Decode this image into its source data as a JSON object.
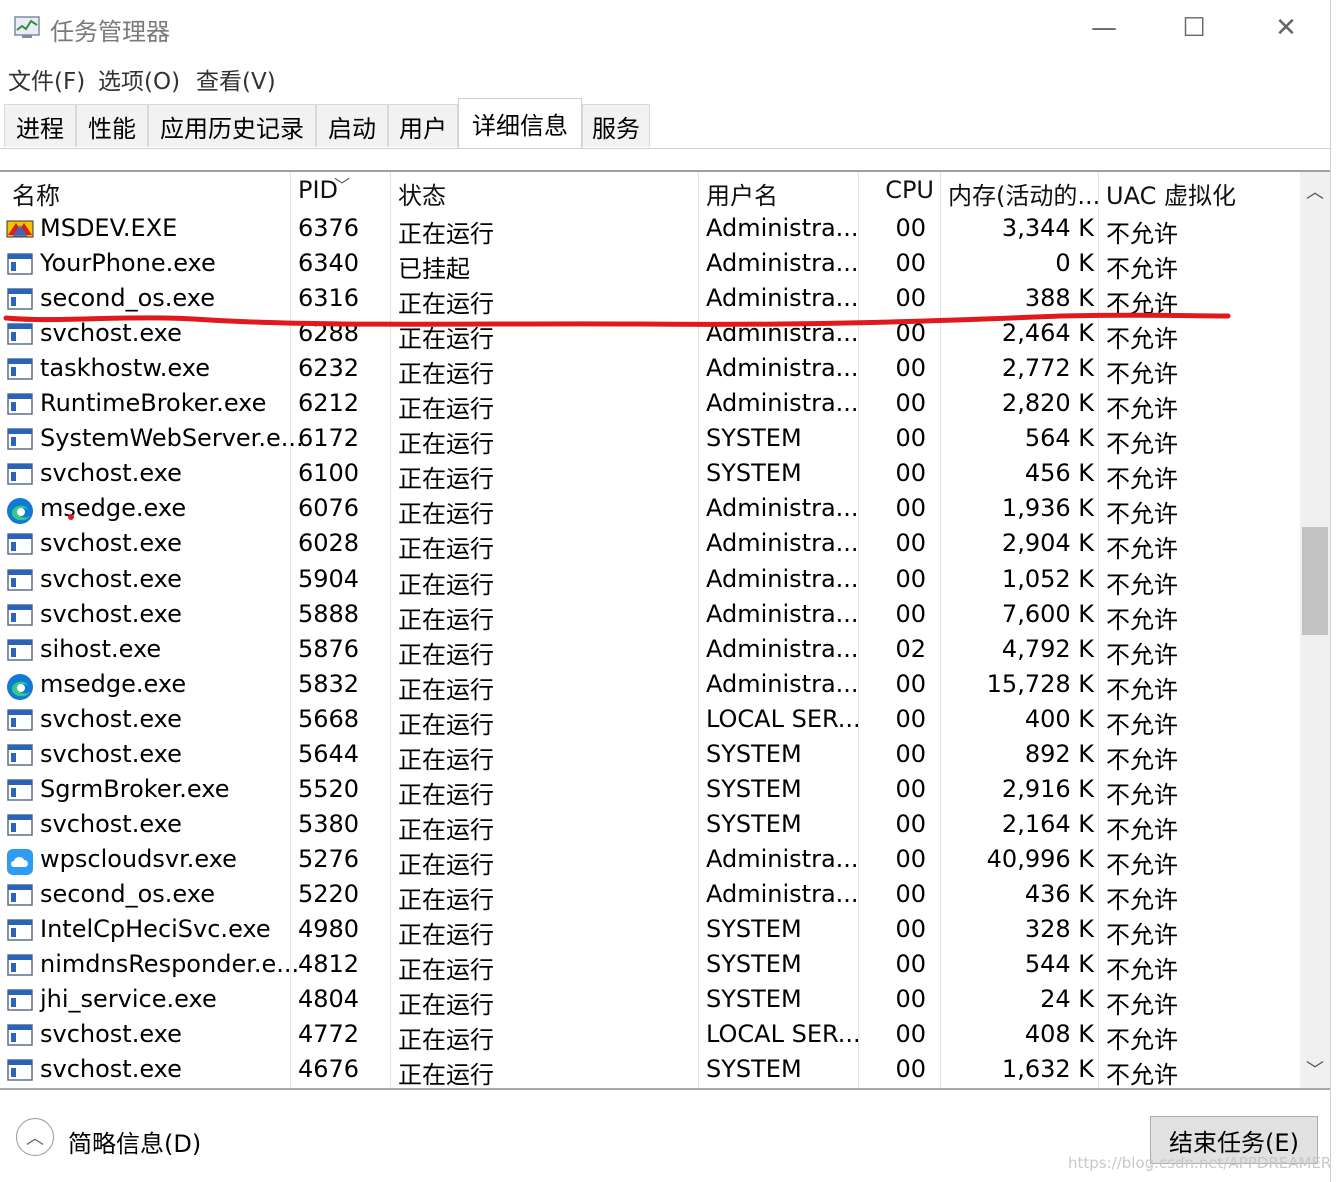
{
  "window": {
    "title": "任务管理器",
    "controls": {
      "minimize": "—",
      "maximize": "☐",
      "close": "✕"
    }
  },
  "menu": [
    "文件(F)",
    "选项(O)",
    "查看(V)"
  ],
  "tabs": [
    {
      "label": "进程",
      "active": false
    },
    {
      "label": "性能",
      "active": false
    },
    {
      "label": "应用历史记录",
      "active": false
    },
    {
      "label": "启动",
      "active": false
    },
    {
      "label": "用户",
      "active": false
    },
    {
      "label": "详细信息",
      "active": true
    },
    {
      "label": "服务",
      "active": false
    }
  ],
  "table": {
    "columns": [
      "名称",
      "PID",
      "状态",
      "用户名",
      "CPU",
      "内存(活动的...",
      "UAC 虚拟化"
    ],
    "rows": [
      {
        "icon": "msdev-icon",
        "name": "MSDEV.EXE",
        "pid": "6376",
        "status": "正在运行",
        "user": "Administra...",
        "cpu": "00",
        "mem": "3,344 K",
        "uac": "不允许"
      },
      {
        "icon": "app-window-icon",
        "name": "YourPhone.exe",
        "pid": "6340",
        "status": "已挂起",
        "user": "Administra...",
        "cpu": "00",
        "mem": "0 K",
        "uac": "不允许"
      },
      {
        "icon": "app-window-icon",
        "name": "second_os.exe",
        "pid": "6316",
        "status": "正在运行",
        "user": "Administra...",
        "cpu": "00",
        "mem": "388 K",
        "uac": "不允许"
      },
      {
        "icon": "app-window-icon",
        "name": "svchost.exe",
        "pid": "6288",
        "status": "正在运行",
        "user": "Administra...",
        "cpu": "00",
        "mem": "2,464 K",
        "uac": "不允许"
      },
      {
        "icon": "app-window-icon",
        "name": "taskhostw.exe",
        "pid": "6232",
        "status": "正在运行",
        "user": "Administra...",
        "cpu": "00",
        "mem": "2,772 K",
        "uac": "不允许"
      },
      {
        "icon": "app-window-icon",
        "name": "RuntimeBroker.exe",
        "pid": "6212",
        "status": "正在运行",
        "user": "Administra...",
        "cpu": "00",
        "mem": "2,820 K",
        "uac": "不允许"
      },
      {
        "icon": "app-window-icon",
        "name": "SystemWebServer.e...",
        "pid": "6172",
        "status": "正在运行",
        "user": "SYSTEM",
        "cpu": "00",
        "mem": "564 K",
        "uac": "不允许"
      },
      {
        "icon": "app-window-icon",
        "name": "svchost.exe",
        "pid": "6100",
        "status": "正在运行",
        "user": "SYSTEM",
        "cpu": "00",
        "mem": "456 K",
        "uac": "不允许"
      },
      {
        "icon": "edge-icon",
        "name": "msedge.exe",
        "pid": "6076",
        "status": "正在运行",
        "user": "Administra...",
        "cpu": "00",
        "mem": "1,936 K",
        "uac": "不允许"
      },
      {
        "icon": "app-window-icon",
        "name": "svchost.exe",
        "pid": "6028",
        "status": "正在运行",
        "user": "Administra...",
        "cpu": "00",
        "mem": "2,904 K",
        "uac": "不允许"
      },
      {
        "icon": "app-window-icon",
        "name": "svchost.exe",
        "pid": "5904",
        "status": "正在运行",
        "user": "Administra...",
        "cpu": "00",
        "mem": "1,052 K",
        "uac": "不允许"
      },
      {
        "icon": "app-window-icon",
        "name": "svchost.exe",
        "pid": "5888",
        "status": "正在运行",
        "user": "Administra...",
        "cpu": "00",
        "mem": "7,600 K",
        "uac": "不允许"
      },
      {
        "icon": "app-window-icon",
        "name": "sihost.exe",
        "pid": "5876",
        "status": "正在运行",
        "user": "Administra...",
        "cpu": "02",
        "mem": "4,792 K",
        "uac": "不允许"
      },
      {
        "icon": "edge-icon",
        "name": "msedge.exe",
        "pid": "5832",
        "status": "正在运行",
        "user": "Administra...",
        "cpu": "00",
        "mem": "15,728 K",
        "uac": "不允许"
      },
      {
        "icon": "app-window-icon",
        "name": "svchost.exe",
        "pid": "5668",
        "status": "正在运行",
        "user": "LOCAL SER...",
        "cpu": "00",
        "mem": "400 K",
        "uac": "不允许"
      },
      {
        "icon": "app-window-icon",
        "name": "svchost.exe",
        "pid": "5644",
        "status": "正在运行",
        "user": "SYSTEM",
        "cpu": "00",
        "mem": "892 K",
        "uac": "不允许"
      },
      {
        "icon": "app-window-icon",
        "name": "SgrmBroker.exe",
        "pid": "5520",
        "status": "正在运行",
        "user": "SYSTEM",
        "cpu": "00",
        "mem": "2,916 K",
        "uac": "不允许"
      },
      {
        "icon": "app-window-icon",
        "name": "svchost.exe",
        "pid": "5380",
        "status": "正在运行",
        "user": "SYSTEM",
        "cpu": "00",
        "mem": "2,164 K",
        "uac": "不允许"
      },
      {
        "icon": "cloud-icon",
        "name": "wpscloudsvr.exe",
        "pid": "5276",
        "status": "正在运行",
        "user": "Administra...",
        "cpu": "00",
        "mem": "40,996 K",
        "uac": "不允许"
      },
      {
        "icon": "app-window-icon",
        "name": "second_os.exe",
        "pid": "5220",
        "status": "正在运行",
        "user": "Administra...",
        "cpu": "00",
        "mem": "436 K",
        "uac": "不允许"
      },
      {
        "icon": "app-window-icon",
        "name": "IntelCpHeciSvc.exe",
        "pid": "4980",
        "status": "正在运行",
        "user": "SYSTEM",
        "cpu": "00",
        "mem": "328 K",
        "uac": "不允许"
      },
      {
        "icon": "app-window-icon",
        "name": "nimdnsResponder.e...",
        "pid": "4812",
        "status": "正在运行",
        "user": "SYSTEM",
        "cpu": "00",
        "mem": "544 K",
        "uac": "不允许"
      },
      {
        "icon": "app-window-icon",
        "name": "jhi_service.exe",
        "pid": "4804",
        "status": "正在运行",
        "user": "SYSTEM",
        "cpu": "00",
        "mem": "24 K",
        "uac": "不允许"
      },
      {
        "icon": "app-window-icon",
        "name": "svchost.exe",
        "pid": "4772",
        "status": "正在运行",
        "user": "LOCAL SER...",
        "cpu": "00",
        "mem": "408 K",
        "uac": "不允许"
      },
      {
        "icon": "app-window-icon",
        "name": "svchost.exe",
        "pid": "4676",
        "status": "正在运行",
        "user": "SYSTEM",
        "cpu": "00",
        "mem": "1,632 K",
        "uac": "不允许"
      }
    ]
  },
  "annotation": {
    "color": "#e0191e"
  },
  "footer": {
    "fewer_details": "简略信息(D)",
    "end_task": "结束任务(E)",
    "watermark": "https://blog.csdn.net/APPDREAMER"
  }
}
